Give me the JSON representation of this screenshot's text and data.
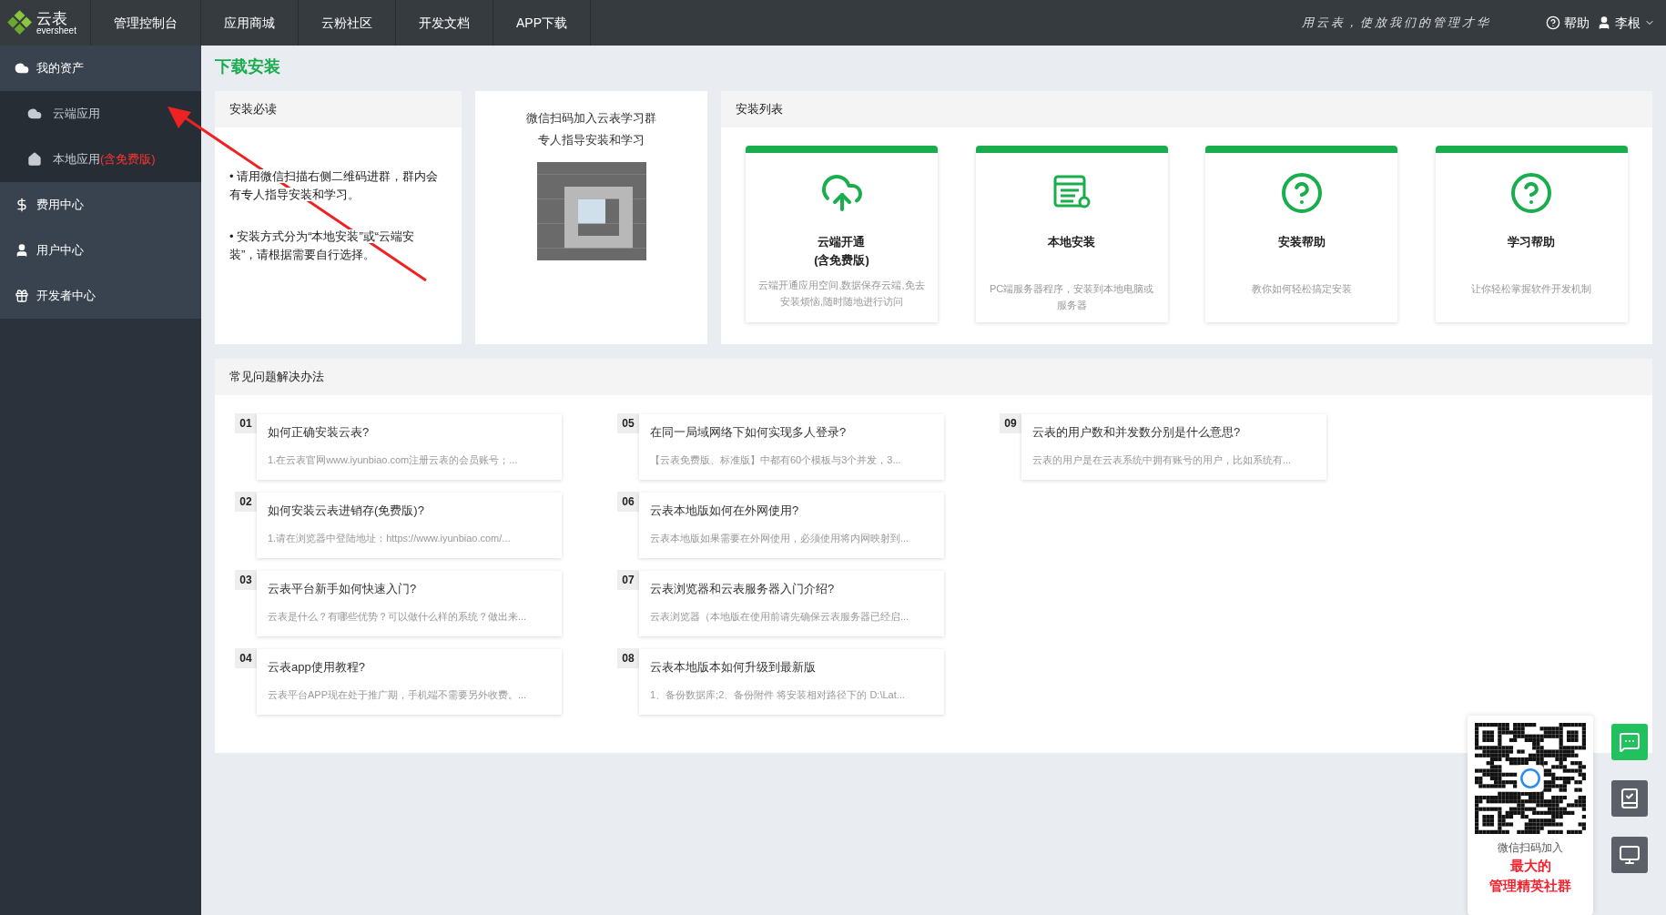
{
  "topbar": {
    "logo_text": "云表",
    "logo_sub": "eversheet",
    "nav": [
      {
        "label": "管理控制台",
        "selected": false
      },
      {
        "label": "应用商城",
        "selected": false
      },
      {
        "label": "云粉社区",
        "selected": false
      },
      {
        "label": "开发文档",
        "selected": false
      },
      {
        "label": "APP下载",
        "selected": false
      }
    ],
    "slogan": "用云表，使放我们的管理才华",
    "help": "帮助",
    "user": "李根"
  },
  "sidebar": {
    "items": [
      {
        "label": "我的资产",
        "children": [
          {
            "label": "云端应用",
            "selected": false
          },
          {
            "label": "本地应用",
            "note": "(含免费版)",
            "selected": false
          }
        ]
      },
      {
        "label": "费用中心"
      },
      {
        "label": "用户中心"
      },
      {
        "label": "开发者中心"
      }
    ]
  },
  "page_title": "下载安装",
  "must_read": {
    "title": "安装必读",
    "points": [
      "• 请用微信扫描右侧二维码进群，群内会有专人指导安装和学习。",
      "• 安装方式分为“本地安装”或“云端安装”，请根据需要自行选择。"
    ]
  },
  "qr_card": {
    "lines": [
      "微信扫码加入云表学习群",
      "专人指导安装和学习"
    ]
  },
  "install_list": {
    "title": "安装列表",
    "items": [
      {
        "kind": "cloud",
        "title": "云端开通",
        "subtitle": "(含免费版)",
        "desc": "云端开通应用空间,数据保存云端,免去安装烦恼,随时随地进行访问"
      },
      {
        "kind": "server",
        "title": "本地安装",
        "desc": "PC端服务器程序，安装到本地电脑或服务器"
      },
      {
        "kind": "help",
        "title": "安装帮助",
        "desc": "教你如何轻松搞定安装"
      },
      {
        "kind": "help",
        "title": "学习帮助",
        "desc": "让你轻松掌握软件开发机制"
      }
    ]
  },
  "faq": {
    "title": "常见问题解决办法",
    "items": [
      {
        "num": "01",
        "q": "如何正确安装云表?",
        "a": "1.在云表官网www.iyunbiao.com注册云表的会员账号；..."
      },
      {
        "num": "02",
        "q": "如何安装云表进销存(免费版)?",
        "a": "1.请在浏览器中登陆地址：https://www.iyunbiao.com/..."
      },
      {
        "num": "03",
        "q": "云表平台新手如何快速入门?",
        "a": "云表是什么？有哪些优势？可以做什么样的系统？做出来..."
      },
      {
        "num": "04",
        "q": "云表app使用教程?",
        "a": "云表平台APP现在处于推广期，手机端不需要另外收费。..."
      },
      {
        "num": "05",
        "q": "在同一局域网络下如何实现多人登录?",
        "a": "【云表免费版、标准版】中都有60个模板与3个并发，3..."
      },
      {
        "num": "06",
        "q": "云表本地版如何在外网使用?",
        "a": "云表本地版如果需要在外网使用，必须使用将内网映射到..."
      },
      {
        "num": "07",
        "q": "云表浏览器和云表服务器入门介绍?",
        "a": "云表浏览器（本地版在使用前请先确保云表服务器已经启..."
      },
      {
        "num": "08",
        "q": "云表本地版本如何升级到最新版",
        "a": "1、备份数据库;2、备份附件 将安装相对路径下的 D:\\Lat..."
      },
      {
        "num": "09",
        "q": "云表的用户数和并发数分别是什么意思?",
        "a": "云表的用户是在云表系统中拥有账号的用户，比如系统有..."
      }
    ]
  },
  "float_widget": {
    "caption": "微信扫码加入",
    "highlight": [
      "最大的",
      "管理精英社群"
    ],
    "buttons": [
      {
        "kind": "wechat",
        "selected": true
      },
      {
        "kind": "book",
        "selected": false
      },
      {
        "kind": "monitor",
        "selected": false
      }
    ]
  }
}
